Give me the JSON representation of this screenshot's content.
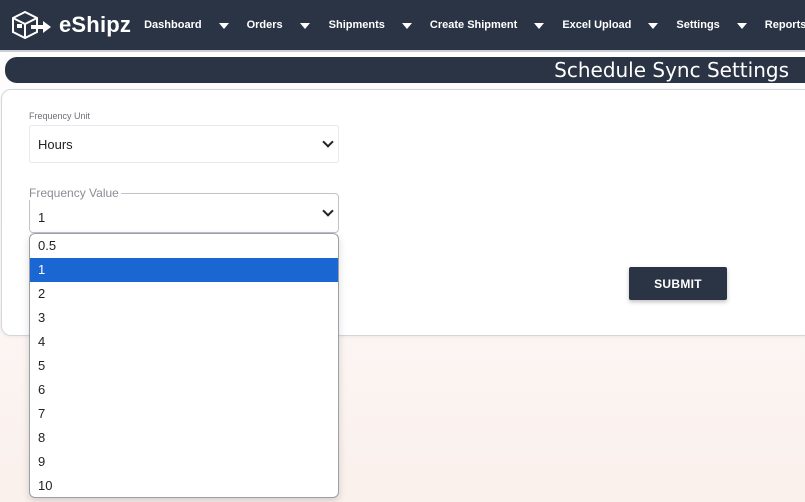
{
  "app": {
    "logo_text": "eShipz",
    "logo_icon": "package-arrow-icon"
  },
  "nav": {
    "items": [
      {
        "label": "Dashboard"
      },
      {
        "label": "Orders"
      },
      {
        "label": "Shipments"
      },
      {
        "label": "Create Shipment"
      },
      {
        "label": "Excel Upload"
      },
      {
        "label": "Settings"
      },
      {
        "label": "Reports"
      }
    ]
  },
  "page": {
    "title": "Schedule Sync Settings"
  },
  "form": {
    "frequency_unit_label": "Frequency Unit",
    "frequency_unit_value": "Hours",
    "frequency_value_label": "Frequency Value",
    "frequency_value_value": "1",
    "submit_label": "SUBMIT"
  },
  "dropdown": {
    "selected": "1",
    "options": [
      "0.5",
      "1",
      "2",
      "3",
      "4",
      "5",
      "6",
      "7",
      "8",
      "9",
      "10"
    ]
  },
  "colors": {
    "nav_bg": "#2b3445",
    "selected_option": "#1a66d2"
  }
}
